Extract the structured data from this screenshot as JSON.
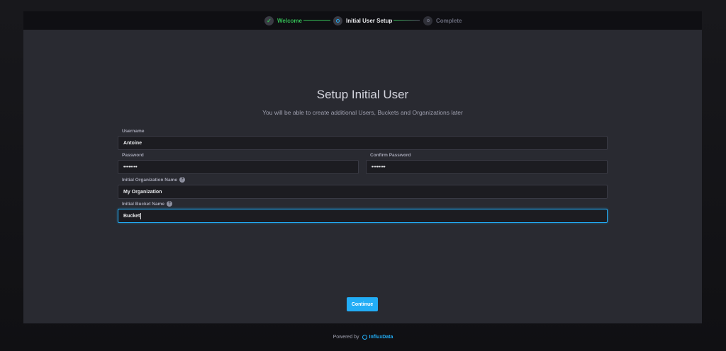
{
  "stepper": {
    "steps": [
      {
        "label": "Welcome",
        "state": "done"
      },
      {
        "label": "Initial User Setup",
        "state": "current"
      },
      {
        "label": "Complete",
        "state": "pending"
      }
    ]
  },
  "form": {
    "title": "Setup Initial User",
    "subtitle": "You will be able to create additional Users, Buckets and Organizations later",
    "username_label": "Username",
    "username_value": "Antoine",
    "password_label": "Password",
    "password_value": "••••••••",
    "confirm_password_label": "Confirm Password",
    "confirm_password_value": "••••••••",
    "org_label": "Initial Organization Name",
    "org_value": "My Organization",
    "bucket_label": "Initial Bucket Name",
    "bucket_value": "Bucket",
    "continue_label": "Continue"
  },
  "footer": {
    "powered_by": "Powered by",
    "brand": "InfluxData"
  },
  "colors": {
    "accent": "#22adf6",
    "success": "#34bb55",
    "panel": "#292a31"
  },
  "icons": {
    "welcome_step": "check-icon",
    "user_step": "current-step-icon",
    "complete_step": "pending-step-icon",
    "help": "question-mark-icon",
    "brand_logo": "influxdata-logo-icon"
  }
}
